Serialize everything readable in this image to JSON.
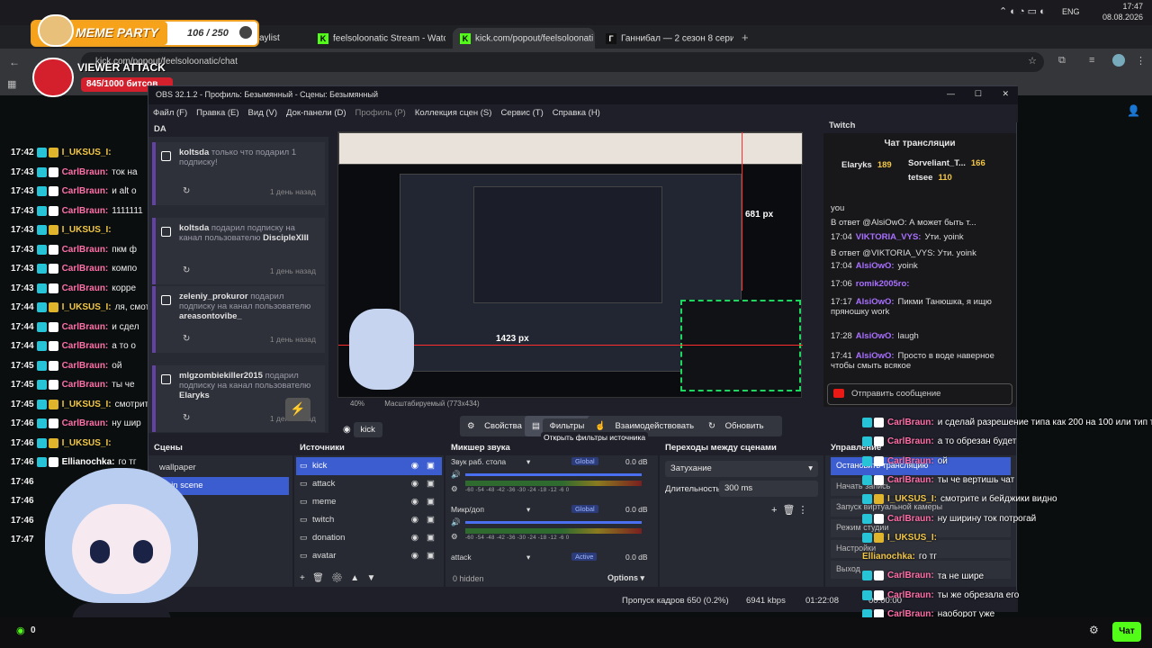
{
  "system": {
    "time": "17:47",
    "date": "08.08.2026",
    "lang": "ENG"
  },
  "browser": {
    "tabs": [
      {
        "label": "aylist"
      },
      {
        "label": "feelsoloonatic Stream - Watch"
      },
      {
        "label": "kick.com/popout/feelsoloonati"
      },
      {
        "label": "Ганнибал — 2 сезон 8 серия"
      }
    ],
    "url": "kick.com/popout/feelsoloonatic/chat"
  },
  "overlay": {
    "meme_title": "MEME PARTY",
    "meme_progress": "106 / 250",
    "viewer_title": "VIEWER ATTACK",
    "viewer_progress": "845/1000 битсов"
  },
  "left_chat": [
    {
      "time": "17:42",
      "nick": "I_UKSUS_I:",
      "text": "",
      "color": "yellow"
    },
    {
      "time": "17:43",
      "nick": "CarlBraun:",
      "text": "ток на",
      "color": "pink"
    },
    {
      "time": "17:43",
      "nick": "CarlBraun:",
      "text": "и alt о",
      "color": "pink"
    },
    {
      "time": "17:43",
      "nick": "CarlBraun:",
      "text": "1111111",
      "color": "pink"
    },
    {
      "time": "17:43",
      "nick": "I_UKSUS_I:",
      "text": "",
      "color": "yellow"
    },
    {
      "time": "17:43",
      "nick": "CarlBraun:",
      "text": "пкм ф",
      "color": "pink"
    },
    {
      "time": "17:43",
      "nick": "CarlBraun:",
      "text": "компо",
      "color": "pink"
    },
    {
      "time": "17:43",
      "nick": "CarlBraun:",
      "text": "корре",
      "color": "pink"
    },
    {
      "time": "17:44",
      "nick": "I_UKSUS_I:",
      "text": "ля, смотр",
      "color": "yellow"
    },
    {
      "time": "17:44",
      "nick": "CarlBraun:",
      "text": "и сдел",
      "color": "pink"
    },
    {
      "time": "17:44",
      "nick": "CarlBraun:",
      "text": "а то о",
      "color": "pink"
    },
    {
      "time": "17:45",
      "nick": "CarlBraun:",
      "text": "ой",
      "color": "pink"
    },
    {
      "time": "17:45",
      "nick": "CarlBraun:",
      "text": "ты че",
      "color": "pink"
    },
    {
      "time": "17:45",
      "nick": "I_UKSUS_I:",
      "text": "смотрите",
      "color": "yellow"
    },
    {
      "time": "17:46",
      "nick": "CarlBraun:",
      "text": "ну шир",
      "color": "pink"
    },
    {
      "time": "17:46",
      "nick": "I_UKSUS_I:",
      "text": "",
      "color": "yellow"
    },
    {
      "time": "17:46",
      "nick": "Ellianochka:",
      "text": "го тг",
      "color": "white"
    },
    {
      "time": "17:46",
      "nick": "",
      "text": "",
      "color": "white"
    },
    {
      "time": "17:46",
      "nick": "",
      "text": "",
      "color": "white"
    },
    {
      "time": "17:46",
      "nick": "",
      "text": "",
      "color": "white"
    },
    {
      "time": "17:47",
      "nick": "",
      "text": "",
      "color": "white"
    }
  ],
  "obs": {
    "title": "OBS 32.1.2 - Профиль: Безымянный - Сцены: Безымянный",
    "menu": [
      "Файл (F)",
      "Правка (E)",
      "Вид (V)",
      "Док-панели (D)",
      "Профиль (P)",
      "Коллекция сцен (S)",
      "Сервис (T)",
      "Справка (H)"
    ],
    "da_title": "DA",
    "da_items": [
      {
        "name": "koltsda",
        "text": "только что подарил 1 подписку!",
        "target": "",
        "ago": "1 день назад"
      },
      {
        "name": "koltsda",
        "text": "подарил подписку на канал пользователю",
        "target": "DiscipleXIII",
        "ago": "1 день назад"
      },
      {
        "name": "zeleniy_prokuror",
        "text": "подарил подписку на канал пользователю",
        "target": "areasontovibe_",
        "ago": "1 день назад"
      },
      {
        "name": "mlgzombiekiller2015",
        "text": "подарил подписку на канал пользователю",
        "target": "Elaryks",
        "ago": "1 день назад"
      }
    ],
    "preview": {
      "dim1": "681 px",
      "dim2": "1423 px",
      "zoom": "40%",
      "scale_label": "Масштабируемый (773x434)"
    },
    "source_bar": {
      "source": "kick",
      "properties": "Свойства",
      "filters": "Фильтры",
      "interact": "Взаимодействовать",
      "refresh": "Обновить",
      "tooltip": "Открыть фильтры источника"
    },
    "scenes_title": "Сцены",
    "scenes": [
      "wallpaper",
      "main scene",
      "jice"
    ],
    "sources_title": "Источники",
    "sources": [
      "kick",
      "attack",
      "meme",
      "twitch",
      "donation",
      "avatar"
    ],
    "mixer_title": "Микшер звука",
    "mixer": [
      {
        "name": "Звук раб. стола",
        "badge": "Global",
        "db": "0.0 dB"
      },
      {
        "name": "Микр/доп",
        "badge": "Global",
        "db": "0.0 dB"
      },
      {
        "name": "attack",
        "badge": "Active",
        "db": "0.0 dB"
      }
    ],
    "mixer_ticks": "-60 -54 -48 -42 -36 -30 -24 -18 -12 -6 0",
    "mixer_hidden": "0 hidden",
    "mixer_options": "Options",
    "transitions_title": "Переходы между сценами",
    "transition": "Затухание",
    "duration_label": "Длительность",
    "duration_value": "300 ms",
    "controls_title": "Управление",
    "controls": [
      "Остановить трансляцию",
      "Начать запись",
      "Запуск виртуальной камеры",
      "Режим студии",
      "Настройки",
      "Выход"
    ],
    "status": {
      "dropped": "Пропуск кадров 650 (0.2%)",
      "bitrate": "6941 kbps",
      "time1": "01:22:08",
      "time2": "00:00:00"
    },
    "twitch_title": "Twitch",
    "twitch_chat_header": "Чат трансляции",
    "twitch_leaders": [
      {
        "name": "Elaryks",
        "count": "189"
      },
      {
        "name": "Sorveliant_T...",
        "count": "166"
      },
      {
        "name": "tetsee",
        "count": "110"
      }
    ],
    "twitch_chat": [
      {
        "time": "",
        "nick": "",
        "text": "you"
      },
      {
        "time": "",
        "nick": "",
        "text": "В ответ @AlsiOwO: А может быть т..."
      },
      {
        "time": "17:04",
        "nick": "VIKTORIA_VYS:",
        "text": "Ути. yoink"
      },
      {
        "time": "",
        "nick": "",
        "text": "В ответ @VIKTORIA_VYS: Ути. yoink"
      },
      {
        "time": "17:04",
        "nick": "AlsiOwO:",
        "text": "yoink"
      },
      {
        "time": "17:06",
        "nick": "romik2005ro:",
        "text": ""
      },
      {
        "time": "17:17",
        "nick": "AlsiOwO:",
        "text": "Пикми Танюшка, я ищю пряношку work"
      },
      {
        "time": "17:28",
        "nick": "AlsiOwO:",
        "text": "laugh"
      },
      {
        "time": "17:41",
        "nick": "AlsiOwO:",
        "text": "Просто в воде наверное чтобы смыть всякое"
      }
    ],
    "twitch_input": "Отправить сообщение"
  },
  "overlay_chat": [
    {
      "nick": "CarlBraun:",
      "text": "и сделай разрешение типа как 200 на 100 или тип т"
    },
    {
      "nick": "CarlBraun:",
      "text": "а то обрезан будет"
    },
    {
      "nick": "CarlBraun:",
      "text": "ой"
    },
    {
      "nick": "CarlBraun:",
      "text": "ты че вертишь чат"
    },
    {
      "nick": "I_UKSUS_I:",
      "text": "смотрите      и бейджики видно"
    },
    {
      "nick": "CarlBraun:",
      "text": "ну ширину ток потрогай"
    },
    {
      "nick": "I_UKSUS_I:",
      "text": ""
    },
    {
      "nick": "Ellianochka:",
      "text": "го тг"
    },
    {
      "nick": "CarlBraun:",
      "text": "та не шире"
    },
    {
      "nick": "CarlBraun:",
      "text": "ты же обрезала его"
    },
    {
      "nick": "CarlBraun:",
      "text": "наоборот уже"
    },
    {
      "nick": "CarlBraun:",
      "text": "300"
    }
  ],
  "bottom": {
    "viewers": "0",
    "chat_button": "Чат"
  },
  "colors": {
    "kick_green": "#53fc18",
    "obs_select": "#3c5dd0",
    "pink": "#ff6fa8",
    "yellow": "#f2c744"
  }
}
